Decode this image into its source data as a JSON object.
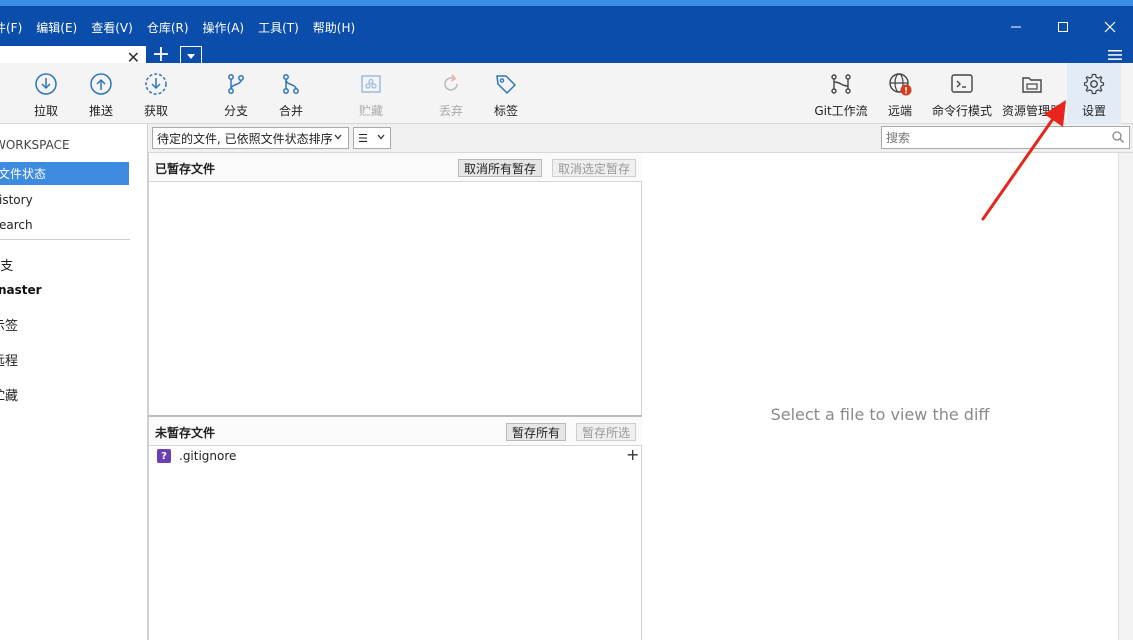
{
  "menu": {
    "items": [
      "件(F)",
      "编辑(E)",
      "查看(V)",
      "仓库(R)",
      "操作(A)",
      "工具(T)",
      "帮助(H)"
    ]
  },
  "window": {
    "minimize": "—",
    "maximize": "☐",
    "close": "✕"
  },
  "tabs": {
    "close_glyph": "✕",
    "add_glyph": "+"
  },
  "toolbar": {
    "pull": "拉取",
    "push": "推送",
    "fetch": "获取",
    "branch": "分支",
    "merge": "合并",
    "stash": "贮藏",
    "discard": "丢弃",
    "tag": "标签",
    "git_flow": "Git工作流",
    "remote": "远端",
    "terminal": "命令行模式",
    "explorer": "资源管理器",
    "settings": "设置"
  },
  "sidebar": {
    "workspace_heading": "WORKSPACE",
    "items": [
      "文件状态",
      "History",
      "Search"
    ],
    "sections": [
      "分支",
      "标签",
      "远程",
      "贮藏"
    ],
    "current_branch": "master",
    "items_visible": [
      "文件状态",
      "istory",
      "earch"
    ],
    "sections_visible": [
      "}支",
      "示签",
      "远程",
      "贮藏"
    ],
    "branch_visible": "naster"
  },
  "filter": {
    "sort_label": "待定的文件, 已依照文件状态排序",
    "view_glyph": "☰",
    "search_placeholder": "搜索"
  },
  "staged": {
    "title": "已暂存文件",
    "unstage_all": "取消所有暂存",
    "unstage_selected": "取消选定暂存"
  },
  "unstaged": {
    "title": "未暂存文件",
    "stage_all": "暂存所有",
    "stage_selected": "暂存所选",
    "files": [
      {
        "status": "?",
        "name": ".gitignore"
      }
    ],
    "add_glyph": "+"
  },
  "diff": {
    "empty_message": "Select a file to view the diff"
  },
  "colors": {
    "titlebar": "#0b4dab",
    "selection": "#3d8be0",
    "annotation_arrow": "#e8251c",
    "untracked_badge": "#6b3fb5"
  }
}
